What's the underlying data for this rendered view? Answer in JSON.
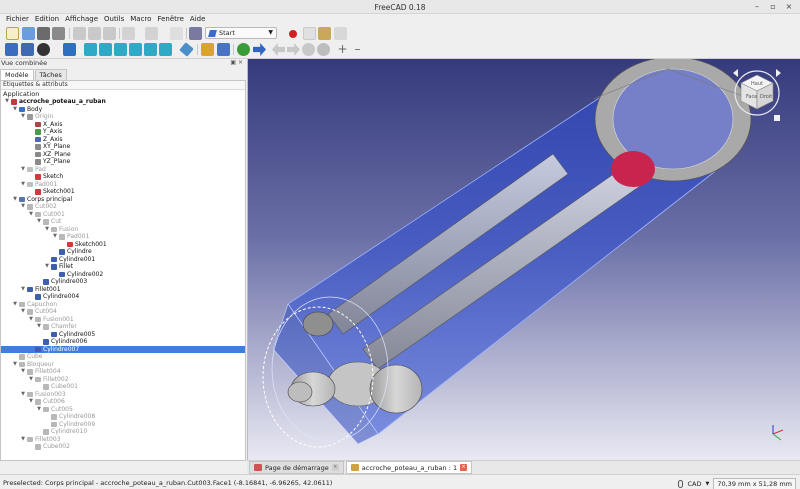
{
  "app": {
    "title": "FreeCAD 0.18"
  },
  "menu": [
    "Fichier",
    "Edition",
    "Affichage",
    "Outils",
    "Macro",
    "Fenêtre",
    "Aide"
  ],
  "toolbar": {
    "workbench": "Start"
  },
  "panel": {
    "title": "Vue combinée",
    "tabs": [
      "Modèle",
      "Tâches"
    ],
    "active_tab": "Modèle",
    "header": "Étiquettes & attributs",
    "section": "Application"
  },
  "tree": [
    {
      "label": "accroche_poteau_a_ruban",
      "depth": 0,
      "icon": "document-icon",
      "color": "#c03b3b",
      "arrow": "down",
      "bold": true
    },
    {
      "label": "Body",
      "depth": 1,
      "icon": "body-icon",
      "color": "#3b6ec8",
      "arrow": "down"
    },
    {
      "label": "Origin",
      "depth": 2,
      "icon": "origin-icon",
      "color": "#9a9a9a",
      "arrow": "down",
      "grey": true
    },
    {
      "label": "X_Axis",
      "depth": 3,
      "icon": "axis-icon",
      "color": "#b04545"
    },
    {
      "label": "Y_Axis",
      "depth": 3,
      "icon": "axis-icon",
      "color": "#4a9a4a"
    },
    {
      "label": "Z_Axis",
      "depth": 3,
      "icon": "axis-icon",
      "color": "#4a6ab0"
    },
    {
      "label": "XY_Plane",
      "depth": 3,
      "icon": "plane-icon",
      "color": "#8a8a8a"
    },
    {
      "label": "XZ_Plane",
      "depth": 3,
      "icon": "plane-icon",
      "color": "#8a8a8a"
    },
    {
      "label": "YZ_Plane",
      "depth": 3,
      "icon": "plane-icon",
      "color": "#8a8a8a"
    },
    {
      "label": "Pad",
      "depth": 2,
      "icon": "pad-icon",
      "color": "#c0c0c0",
      "arrow": "down",
      "grey": true
    },
    {
      "label": "Sketch",
      "depth": 3,
      "icon": "sketch-icon",
      "color": "#d23a3a"
    },
    {
      "label": "Pad001",
      "depth": 2,
      "icon": "pad-icon",
      "color": "#c0c0c0",
      "arrow": "down",
      "grey": true
    },
    {
      "label": "Sketch001",
      "depth": 3,
      "icon": "sketch-icon",
      "color": "#d23a3a"
    },
    {
      "label": "Corps principal",
      "depth": 1,
      "icon": "cut-icon",
      "color": "#5574b8",
      "arrow": "down"
    },
    {
      "label": "Cut002",
      "depth": 2,
      "icon": "cut-icon",
      "color": "#b8b8b8",
      "arrow": "down",
      "grey": true
    },
    {
      "label": "Cut001",
      "depth": 3,
      "icon": "cut-icon",
      "color": "#b8b8b8",
      "arrow": "down",
      "grey": true
    },
    {
      "label": "Cut",
      "depth": 4,
      "icon": "cut-icon",
      "color": "#b8b8b8",
      "arrow": "down",
      "grey": true
    },
    {
      "label": "Fusion",
      "depth": 5,
      "icon": "fusion-icon",
      "color": "#b8b8b8",
      "arrow": "down",
      "grey": true
    },
    {
      "label": "Pad001",
      "depth": 6,
      "icon": "pad-icon",
      "color": "#b8b8b8",
      "arrow": "down",
      "grey": true
    },
    {
      "label": "Sketch001",
      "depth": 7,
      "icon": "sketch-icon",
      "color": "#d23a3a"
    },
    {
      "label": "Cylindre",
      "depth": 6,
      "icon": "cylinder-icon",
      "color": "#3c5fae"
    },
    {
      "label": "Cylindre001",
      "depth": 5,
      "icon": "cylinder-icon",
      "color": "#3c5fae"
    },
    {
      "label": "Fillet",
      "depth": 5,
      "icon": "fillet-icon",
      "color": "#3c5fae",
      "arrow": "down"
    },
    {
      "label": "Cylindre002",
      "depth": 6,
      "icon": "cylinder-icon",
      "color": "#3c5fae"
    },
    {
      "label": "Cylindre003",
      "depth": 4,
      "icon": "cylinder-icon",
      "color": "#3c5fae"
    },
    {
      "label": "Fillet001",
      "depth": 2,
      "icon": "fillet-icon",
      "color": "#3c5fae",
      "arrow": "down"
    },
    {
      "label": "Cylindre004",
      "depth": 3,
      "icon": "cylinder-icon",
      "color": "#3c5fae"
    },
    {
      "label": "Capuchon",
      "depth": 1,
      "icon": "cut-icon",
      "color": "#b8b8b8",
      "arrow": "down",
      "grey": true
    },
    {
      "label": "Cut004",
      "depth": 2,
      "icon": "cut-icon",
      "color": "#b8b8b8",
      "arrow": "down",
      "grey": true
    },
    {
      "label": "Fusion001",
      "depth": 3,
      "icon": "fusion-icon",
      "color": "#b8b8b8",
      "arrow": "down",
      "grey": true
    },
    {
      "label": "Chamfer",
      "depth": 4,
      "icon": "chamfer-icon",
      "color": "#b8b8b8",
      "arrow": "down",
      "grey": true
    },
    {
      "label": "Cylindre005",
      "depth": 5,
      "icon": "cylinder-icon",
      "color": "#3c5fae"
    },
    {
      "label": "Cylindre006",
      "depth": 4,
      "icon": "cylinder-icon",
      "color": "#3c5fae"
    },
    {
      "label": "Cylindre007",
      "depth": 3,
      "icon": "cylinder-icon",
      "color": "#3c5fae",
      "selected": true
    },
    {
      "label": "Cube",
      "depth": 1,
      "icon": "cube-icon",
      "color": "#b8b8b8",
      "grey": true
    },
    {
      "label": "Bloqueur",
      "depth": 1,
      "icon": "cut-icon",
      "color": "#b8b8b8",
      "arrow": "down",
      "grey": true
    },
    {
      "label": "Fillet004",
      "depth": 2,
      "icon": "fillet-icon",
      "color": "#b8b8b8",
      "arrow": "down",
      "grey": true
    },
    {
      "label": "Fillet002",
      "depth": 3,
      "icon": "fillet-icon",
      "color": "#b8b8b8",
      "arrow": "down",
      "grey": true
    },
    {
      "label": "Cube001",
      "depth": 4,
      "icon": "cube-icon",
      "color": "#b8b8b8",
      "grey": true
    },
    {
      "label": "Fusion003",
      "depth": 2,
      "icon": "fusion-icon",
      "color": "#b8b8b8",
      "arrow": "down",
      "grey": true
    },
    {
      "label": "Cut006",
      "depth": 3,
      "icon": "cut-icon",
      "color": "#b8b8b8",
      "arrow": "down",
      "grey": true
    },
    {
      "label": "Cut005",
      "depth": 4,
      "icon": "cut-icon",
      "color": "#b8b8b8",
      "arrow": "down",
      "grey": true
    },
    {
      "label": "Cylindre008",
      "depth": 5,
      "icon": "cylinder-icon",
      "color": "#b8b8b8",
      "grey": true
    },
    {
      "label": "Cylindre009",
      "depth": 5,
      "icon": "cylinder-icon",
      "color": "#b8b8b8",
      "grey": true
    },
    {
      "label": "Cylindre010",
      "depth": 4,
      "icon": "cylinder-icon",
      "color": "#b8b8b8",
      "grey": true
    },
    {
      "label": "Fillet003",
      "depth": 2,
      "icon": "fillet-icon",
      "color": "#b8b8b8",
      "arrow": "down",
      "grey": true
    },
    {
      "label": "Cube002",
      "depth": 3,
      "icon": "cube-icon",
      "color": "#b8b8b8",
      "grey": true
    }
  ],
  "navcube": {
    "top": "Haut",
    "front": "Face",
    "right": "Droit"
  },
  "view_tabs": [
    {
      "label": "Page de démarrage",
      "active": false
    },
    {
      "label": "accroche_poteau_a_ruban : 1",
      "active": true
    }
  ],
  "status": {
    "message": "Preselected: Corps principal - accroche_poteau_a_ruban.Cut003.Face1 (-8.16841, -6.96265, 42.0611)",
    "nav_style": "CAD",
    "dimensions": "70,39 mm x 51,28 mm"
  },
  "colors": {
    "selection": "#3d7fd9",
    "preselect": "#c8244e",
    "body_blue": "#2a4bd6"
  }
}
